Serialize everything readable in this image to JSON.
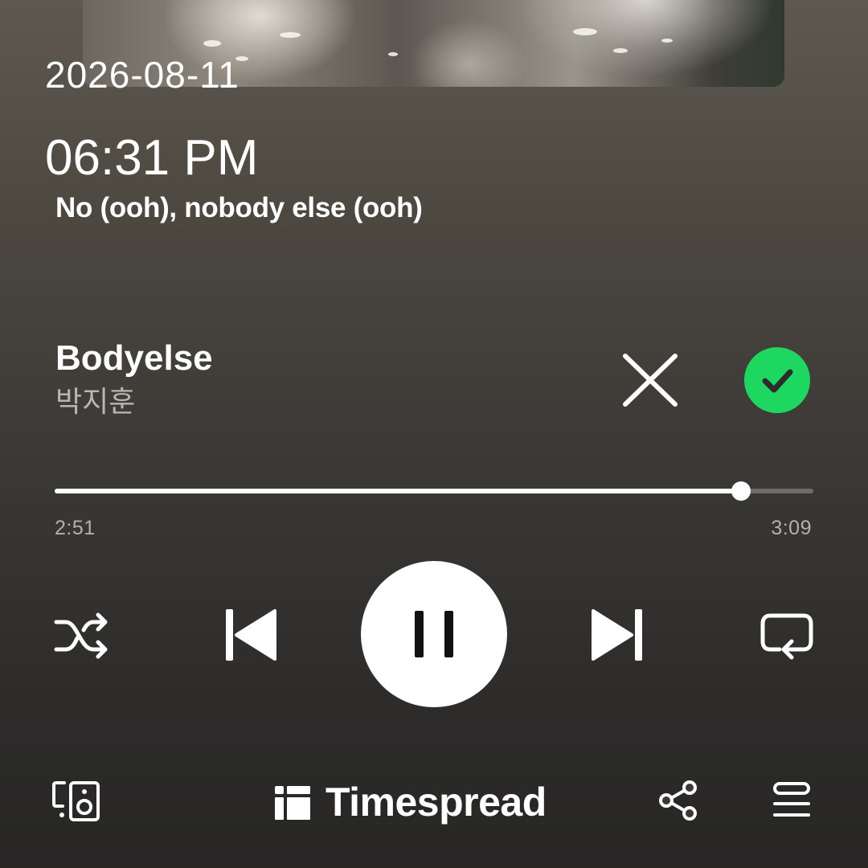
{
  "status": {
    "date": "2026-08-11",
    "time": "06:31 PM"
  },
  "lyrics": {
    "current_line": "No (ooh), nobody else (ooh)"
  },
  "track": {
    "title": "Bodyelse",
    "artist": "박지훈",
    "liked": true
  },
  "playback": {
    "elapsed": "2:51",
    "duration": "3:09",
    "progress_fraction": 0.905,
    "state": "playing"
  },
  "controls": {
    "dismiss_icon": "close-icon",
    "saved_icon": "check-circle-icon",
    "shuffle_icon": "shuffle-icon",
    "previous_icon": "skip-previous-icon",
    "play_pause_icon": "pause-icon",
    "next_icon": "skip-next-icon",
    "repeat_icon": "repeat-icon",
    "devices_icon": "connect-devices-icon",
    "share_icon": "share-icon",
    "queue_icon": "queue-icon"
  },
  "footer": {
    "brand_name": "Timespread",
    "brand_icon": "timespread-logo-icon"
  },
  "colors": {
    "accent_green": "#1ed760",
    "background_top": "#5e5850",
    "background_bottom": "#272625",
    "secondary_text": "#b9b6b1",
    "progress_remaining": "#6f6c68"
  }
}
